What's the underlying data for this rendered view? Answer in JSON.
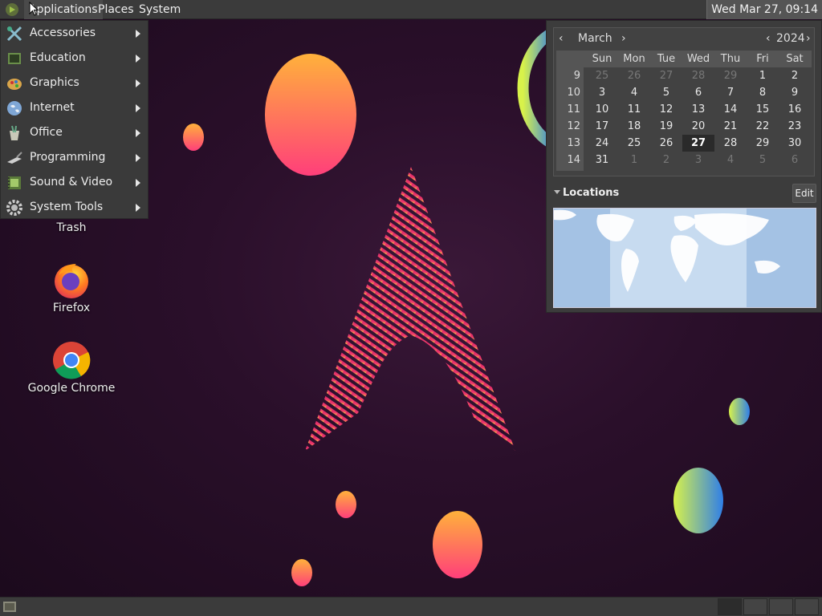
{
  "top_panel": {
    "menus": {
      "applications": "Applications",
      "places": "Places",
      "system": "System"
    },
    "clock": "Wed Mar 27, 09:14"
  },
  "apps_menu": {
    "items": [
      {
        "label": "Accessories",
        "icon": "accessories-icon"
      },
      {
        "label": "Education",
        "icon": "education-icon"
      },
      {
        "label": "Graphics",
        "icon": "graphics-icon"
      },
      {
        "label": "Internet",
        "icon": "internet-icon"
      },
      {
        "label": "Office",
        "icon": "office-icon"
      },
      {
        "label": "Programming",
        "icon": "programming-icon"
      },
      {
        "label": "Sound & Video",
        "icon": "sound-video-icon"
      },
      {
        "label": "System Tools",
        "icon": "system-tools-icon"
      }
    ]
  },
  "desktop": {
    "icons": [
      {
        "label": "Trash",
        "icon": "trash-icon"
      },
      {
        "label": "Firefox",
        "icon": "firefox-icon"
      },
      {
        "label": "Google Chrome",
        "icon": "chrome-icon"
      }
    ]
  },
  "calendar": {
    "month": "March",
    "year": "2024",
    "weekdays": [
      "Sun",
      "Mon",
      "Tue",
      "Wed",
      "Thu",
      "Fri",
      "Sat"
    ],
    "weeks": [
      {
        "week": "9",
        "days": [
          {
            "d": "25",
            "dim": true
          },
          {
            "d": "26",
            "dim": true
          },
          {
            "d": "27",
            "dim": true
          },
          {
            "d": "28",
            "dim": true
          },
          {
            "d": "29",
            "dim": true
          },
          {
            "d": "1"
          },
          {
            "d": "2"
          }
        ]
      },
      {
        "week": "10",
        "days": [
          {
            "d": "3"
          },
          {
            "d": "4"
          },
          {
            "d": "5"
          },
          {
            "d": "6"
          },
          {
            "d": "7"
          },
          {
            "d": "8"
          },
          {
            "d": "9"
          }
        ]
      },
      {
        "week": "11",
        "days": [
          {
            "d": "10"
          },
          {
            "d": "11"
          },
          {
            "d": "12"
          },
          {
            "d": "13"
          },
          {
            "d": "14"
          },
          {
            "d": "15"
          },
          {
            "d": "16"
          }
        ]
      },
      {
        "week": "12",
        "days": [
          {
            "d": "17"
          },
          {
            "d": "18"
          },
          {
            "d": "19"
          },
          {
            "d": "20"
          },
          {
            "d": "21"
          },
          {
            "d": "22"
          },
          {
            "d": "23"
          }
        ]
      },
      {
        "week": "13",
        "days": [
          {
            "d": "24"
          },
          {
            "d": "25"
          },
          {
            "d": "26"
          },
          {
            "d": "27",
            "today": true
          },
          {
            "d": "28"
          },
          {
            "d": "29"
          },
          {
            "d": "30"
          }
        ]
      },
      {
        "week": "14",
        "days": [
          {
            "d": "31"
          },
          {
            "d": "1",
            "dim": true
          },
          {
            "d": "2",
            "dim": true
          },
          {
            "d": "3",
            "dim": true
          },
          {
            "d": "4",
            "dim": true
          },
          {
            "d": "5",
            "dim": true
          },
          {
            "d": "6",
            "dim": true
          }
        ]
      }
    ],
    "locations_label": "Locations",
    "edit_label": "Edit"
  },
  "colors": {
    "panel": "#3b3b3b",
    "menu_bg": "#3a3a3a",
    "desktop_bg": "#2a0f2a",
    "arch_logo_top": "#e0306e",
    "arch_logo_bottom": "#f7c634"
  }
}
